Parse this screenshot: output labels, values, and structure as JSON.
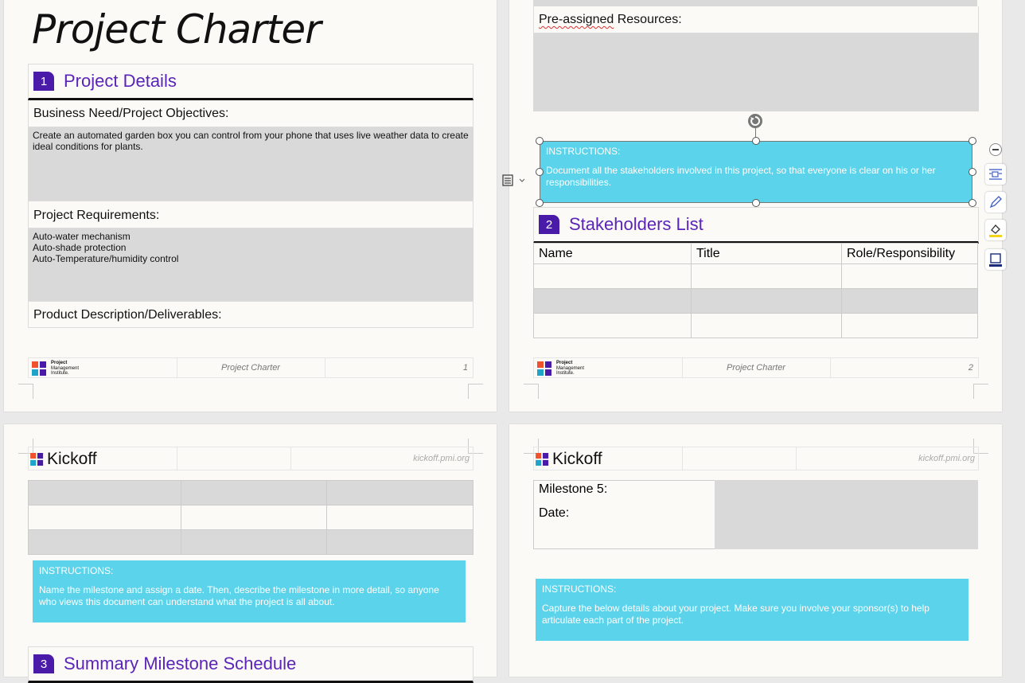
{
  "page1": {
    "title": "Project Charter",
    "section1": {
      "number": "1",
      "title": "Project Details"
    },
    "business_need_label": "Business Need/Project Objectives:",
    "business_need_value": "Create an automated garden box you can control from your phone that uses live weather data to create ideal conditions for plants.",
    "requirements_label": "Project Requirements:",
    "requirements_values": [
      "Auto-water mechanism",
      "Auto-shade protection",
      "Auto-Temperature/humidity control"
    ],
    "deliverables_label": "Product Description/Deliverables:",
    "footer": {
      "logo_lines": [
        "Project",
        "Management",
        "Institute."
      ],
      "center": "Project Charter",
      "page": "1"
    }
  },
  "page2": {
    "resources_label_underlined": "Pre-assigned",
    "resources_label_rest": " Resources:",
    "instructions": {
      "head": "INSTRUCTIONS:",
      "body": "Document all the stakeholders involved in this project, so that everyone is clear on his or her responsibilities."
    },
    "section2": {
      "number": "2",
      "title": "Stakeholders List"
    },
    "table_headers": [
      "Name",
      "Title",
      "Role/Responsibility"
    ],
    "footer": {
      "logo_lines": [
        "Project",
        "Management",
        "Institute."
      ],
      "center": "Project Charter",
      "page": "2"
    }
  },
  "page3": {
    "header": {
      "logo": "Kickoff",
      "url": "kickoff.pmi.org"
    },
    "instructions": {
      "head": "INSTRUCTIONS:",
      "body": "Name the milestone and assign a date. Then, describe the milestone in more detail, so anyone who views this document can understand what the project is all about."
    },
    "section3": {
      "number": "3",
      "title": "Summary Milestone Schedule"
    }
  },
  "page4": {
    "header": {
      "logo": "Kickoff",
      "url": "kickoff.pmi.org"
    },
    "milestone_label": "Milestone 5:",
    "date_label": "Date:",
    "instructions": {
      "head": "INSTRUCTIONS:",
      "body": "Capture the below details about your project. Make sure you involve your sponsor(s) to help articulate each part of the project."
    }
  },
  "colors": {
    "accent": "#5b24b8",
    "badge": "#4a1aa8",
    "instructions_bg": "#5bd3eb",
    "field_gray": "#d9d9d9"
  },
  "icons": [
    "layout-options-icon",
    "rotate-icon",
    "zoom-out-icon",
    "wrap-text-icon",
    "pen-icon",
    "fill-icon",
    "shape-outline-icon"
  ]
}
